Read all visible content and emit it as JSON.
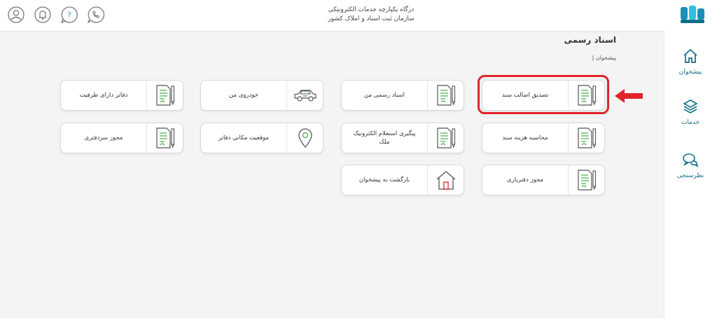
{
  "header": {
    "title_line1": "درگاه یکپارچه خدمات الکترونیکی",
    "title_line2": "سازمان ثبت اسناد و املاک کشور",
    "help_symbol": "?",
    "icons": [
      "user-icon",
      "bell-icon",
      "help-icon",
      "whatsapp-icon"
    ]
  },
  "sidebar": {
    "items": [
      {
        "label": "پیشخوان",
        "icon": "home-icon"
      },
      {
        "label": "خدمات",
        "icon": "layers-icon"
      },
      {
        "label": "نظرسنجی",
        "icon": "chat-icon"
      }
    ]
  },
  "main": {
    "page_title": "اسناد رسمی",
    "breadcrumb": "پیشخوان |",
    "cards": [
      {
        "label": "تصدیق اصالت سند",
        "icon": "document-icon"
      },
      {
        "label": "اسناد رسمی من",
        "icon": "document-icon"
      },
      {
        "label": "خودروی من",
        "icon": "car-icon"
      },
      {
        "label": "دفاتر دارای ظرفیت",
        "icon": "document-icon"
      },
      {
        "label": "محاسبه هزینه سند",
        "icon": "document-icon"
      },
      {
        "label": "پیگیری استعلام الکترونیک ملک",
        "icon": "document-icon"
      },
      {
        "label": "موقعیت مکانی دفاتر",
        "icon": "location-pin-icon"
      },
      {
        "label": "مجوز سردفتری",
        "icon": "document-icon"
      },
      {
        "label": "مجوز دفتریاری",
        "icon": "document-icon"
      },
      {
        "label": "بازگشت به پیشخوان",
        "icon": "house-icon"
      }
    ]
  },
  "colors": {
    "accent": "#0f6f86",
    "icon_green": "#4caf50",
    "highlight": "#e0242b"
  }
}
